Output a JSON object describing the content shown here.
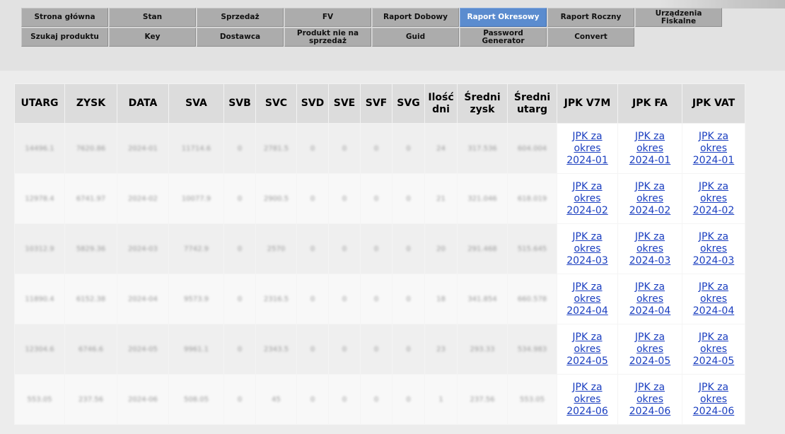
{
  "nav": {
    "items": [
      {
        "label": "Strona główna",
        "active": false
      },
      {
        "label": "Stan",
        "active": false
      },
      {
        "label": "Sprzedaż",
        "active": false
      },
      {
        "label": "FV",
        "active": false
      },
      {
        "label": "Raport Dobowy",
        "active": false
      },
      {
        "label": "Raport Okresowy",
        "active": true
      },
      {
        "label": "Raport Roczny",
        "active": false
      },
      {
        "label": "Urządzenia Fiskalne",
        "active": false
      },
      {
        "label": "Szukaj produktu",
        "active": false
      },
      {
        "label": "Key",
        "active": false
      },
      {
        "label": "Dostawca",
        "active": false
      },
      {
        "label": "Produkt nie na sprzedaż",
        "active": false
      },
      {
        "label": "Guid",
        "active": false
      },
      {
        "label": "Password Generator",
        "active": false
      },
      {
        "label": "Convert",
        "active": false
      }
    ],
    "active_color": "#5b8ccf",
    "button_color": "#acacac"
  },
  "table": {
    "headers": [
      "UTARG",
      "ZYSK",
      "DATA",
      "SVA",
      "SVB",
      "SVC",
      "SVD",
      "SVE",
      "SVF",
      "SVG",
      "Ilość dni",
      "Średni zysk",
      "Średni utarg",
      "JPK V7M",
      "JPK FA",
      "JPK VAT"
    ],
    "rows": [
      {
        "utarg": "14496.1",
        "zysk": "7620.86",
        "data": "2024-01",
        "sva": "11714.6",
        "svb": "0",
        "svc": "2781.5",
        "svd": "0",
        "sve": "0",
        "svf": "0",
        "svg": "0",
        "dni": "24",
        "sredni_zysk": "317.536",
        "sredni_utarg": "604.004",
        "link_line1": "JPK za",
        "link_line2": "okres",
        "link_line3": "2024-01"
      },
      {
        "utarg": "12978.4",
        "zysk": "6741.97",
        "data": "2024-02",
        "sva": "10077.9",
        "svb": "0",
        "svc": "2900.5",
        "svd": "0",
        "sve": "0",
        "svf": "0",
        "svg": "0",
        "dni": "21",
        "sredni_zysk": "321.046",
        "sredni_utarg": "618.019",
        "link_line1": "JPK za",
        "link_line2": "okres",
        "link_line3": "2024-02"
      },
      {
        "utarg": "10312.9",
        "zysk": "5829.36",
        "data": "2024-03",
        "sva": "7742.9",
        "svb": "0",
        "svc": "2570",
        "svd": "0",
        "sve": "0",
        "svf": "0",
        "svg": "0",
        "dni": "20",
        "sredni_zysk": "291.468",
        "sredni_utarg": "515.645",
        "link_line1": "JPK za",
        "link_line2": "okres",
        "link_line3": "2024-03"
      },
      {
        "utarg": "11890.4",
        "zysk": "6152.38",
        "data": "2024-04",
        "sva": "9573.9",
        "svb": "0",
        "svc": "2316.5",
        "svd": "0",
        "sve": "0",
        "svf": "0",
        "svg": "0",
        "dni": "18",
        "sredni_zysk": "341.854",
        "sredni_utarg": "660.578",
        "link_line1": "JPK za",
        "link_line2": "okres",
        "link_line3": "2024-04"
      },
      {
        "utarg": "12304.6",
        "zysk": "6746.6",
        "data": "2024-05",
        "sva": "9961.1",
        "svb": "0",
        "svc": "2343.5",
        "svd": "0",
        "sve": "0",
        "svf": "0",
        "svg": "0",
        "dni": "23",
        "sredni_zysk": "293.33",
        "sredni_utarg": "534.983",
        "link_line1": "JPK za",
        "link_line2": "okres",
        "link_line3": "2024-05"
      },
      {
        "utarg": "553.05",
        "zysk": "237.56",
        "data": "2024-06",
        "sva": "508.05",
        "svb": "0",
        "svc": "45",
        "svd": "0",
        "sve": "0",
        "svf": "0",
        "svg": "0",
        "dni": "1",
        "sredni_zysk": "237.56",
        "sredni_utarg": "553.05",
        "link_line1": "JPK za",
        "link_line2": "okres",
        "link_line3": "2024-06"
      }
    ],
    "link_color": "#1a3ec0"
  }
}
